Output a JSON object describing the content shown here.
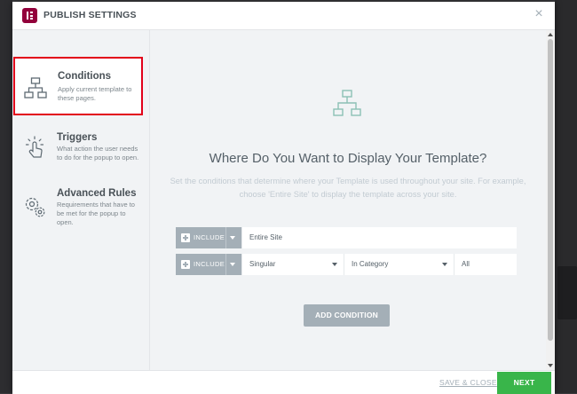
{
  "modal": {
    "title": "PUBLISH SETTINGS",
    "close_glyph": "×",
    "logo_icon": "elementor-logo-icon",
    "logo_color": "#92003b"
  },
  "sidebar": {
    "tabs": [
      {
        "name": "Conditions",
        "description": "Apply current template to these pages.",
        "icon": "sitemap-icon",
        "active": true
      },
      {
        "name": "Triggers",
        "description": "What action the user needs to do for the popup to open.",
        "icon": "pointer-hand-icon",
        "active": false
      },
      {
        "name": "Advanced Rules",
        "description": "Requirements that have to be met for the popup to open.",
        "icon": "gears-icon",
        "active": false
      }
    ]
  },
  "main": {
    "icon": "sitemap-icon",
    "heading": "Where Do You Want to Display Your Template?",
    "description": "Set the conditions that determine where your Template is used throughout your site. For example, choose 'Entire Site' to display the template across your site.",
    "conditions": [
      {
        "type": "INCLUDE",
        "fields": [
          "Entire Site"
        ]
      },
      {
        "type": "INCLUDE",
        "fields": [
          "Singular",
          "In Category",
          "All"
        ]
      }
    ],
    "add_condition_label": "ADD CONDITION"
  },
  "footer": {
    "save_close_label": "SAVE & CLOSE",
    "next_label": "NEXT"
  },
  "colors": {
    "accent_green": "#39b54a",
    "highlight_red": "#e2001a",
    "neutral_button": "#a4afb7",
    "icon_teal": "#8cc0b5"
  }
}
